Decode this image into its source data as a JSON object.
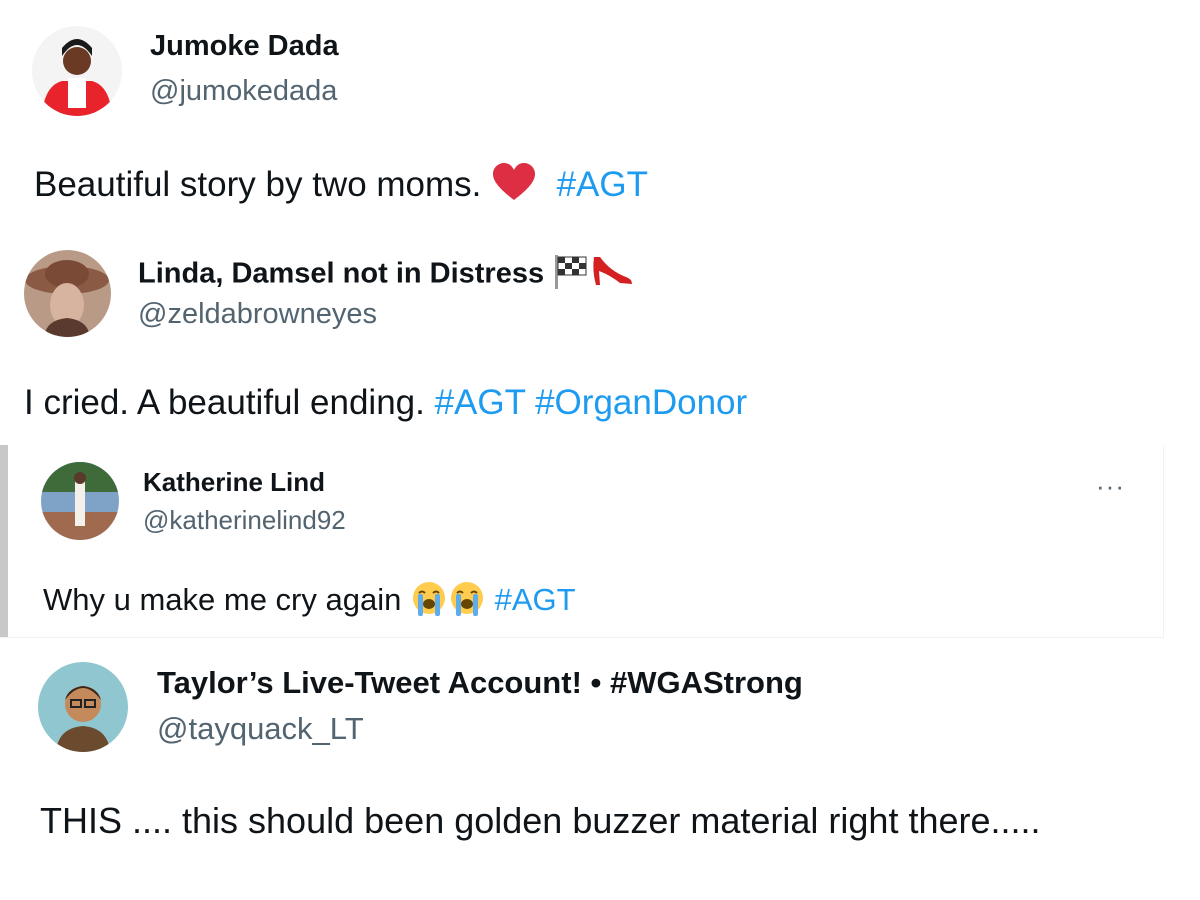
{
  "tweets": [
    {
      "name": "Jumoke Dada",
      "handle": "@jumokedada",
      "text": "Beautiful story by two moms.",
      "emoji": "red-heart",
      "hashtags": [
        "#AGT"
      ]
    },
    {
      "name": "Linda, Damsel not in Distress",
      "handle": "@zeldabrowneyes",
      "text": "I cried. A beautiful ending.",
      "name_emojis": [
        "checkered-flag",
        "high-heel"
      ],
      "hashtags": [
        "#AGT",
        "#OrganDonor"
      ]
    },
    {
      "name": "Katherine Lind",
      "handle": "@katherinelind92",
      "text": "Why u make me cry again",
      "emojis": [
        "loudly-crying-face",
        "loudly-crying-face"
      ],
      "hashtags": [
        "#AGT"
      ],
      "more_label": "···"
    },
    {
      "name": "Taylor’s Live-Tweet Account! • #WGAStrong",
      "handle": "@tayquack_LT",
      "text": "THIS .... this should been golden buzzer material right there....."
    }
  ],
  "colors": {
    "hashtag": "#1d9bf0",
    "handle": "#536471",
    "heart": "#dd2e44"
  }
}
